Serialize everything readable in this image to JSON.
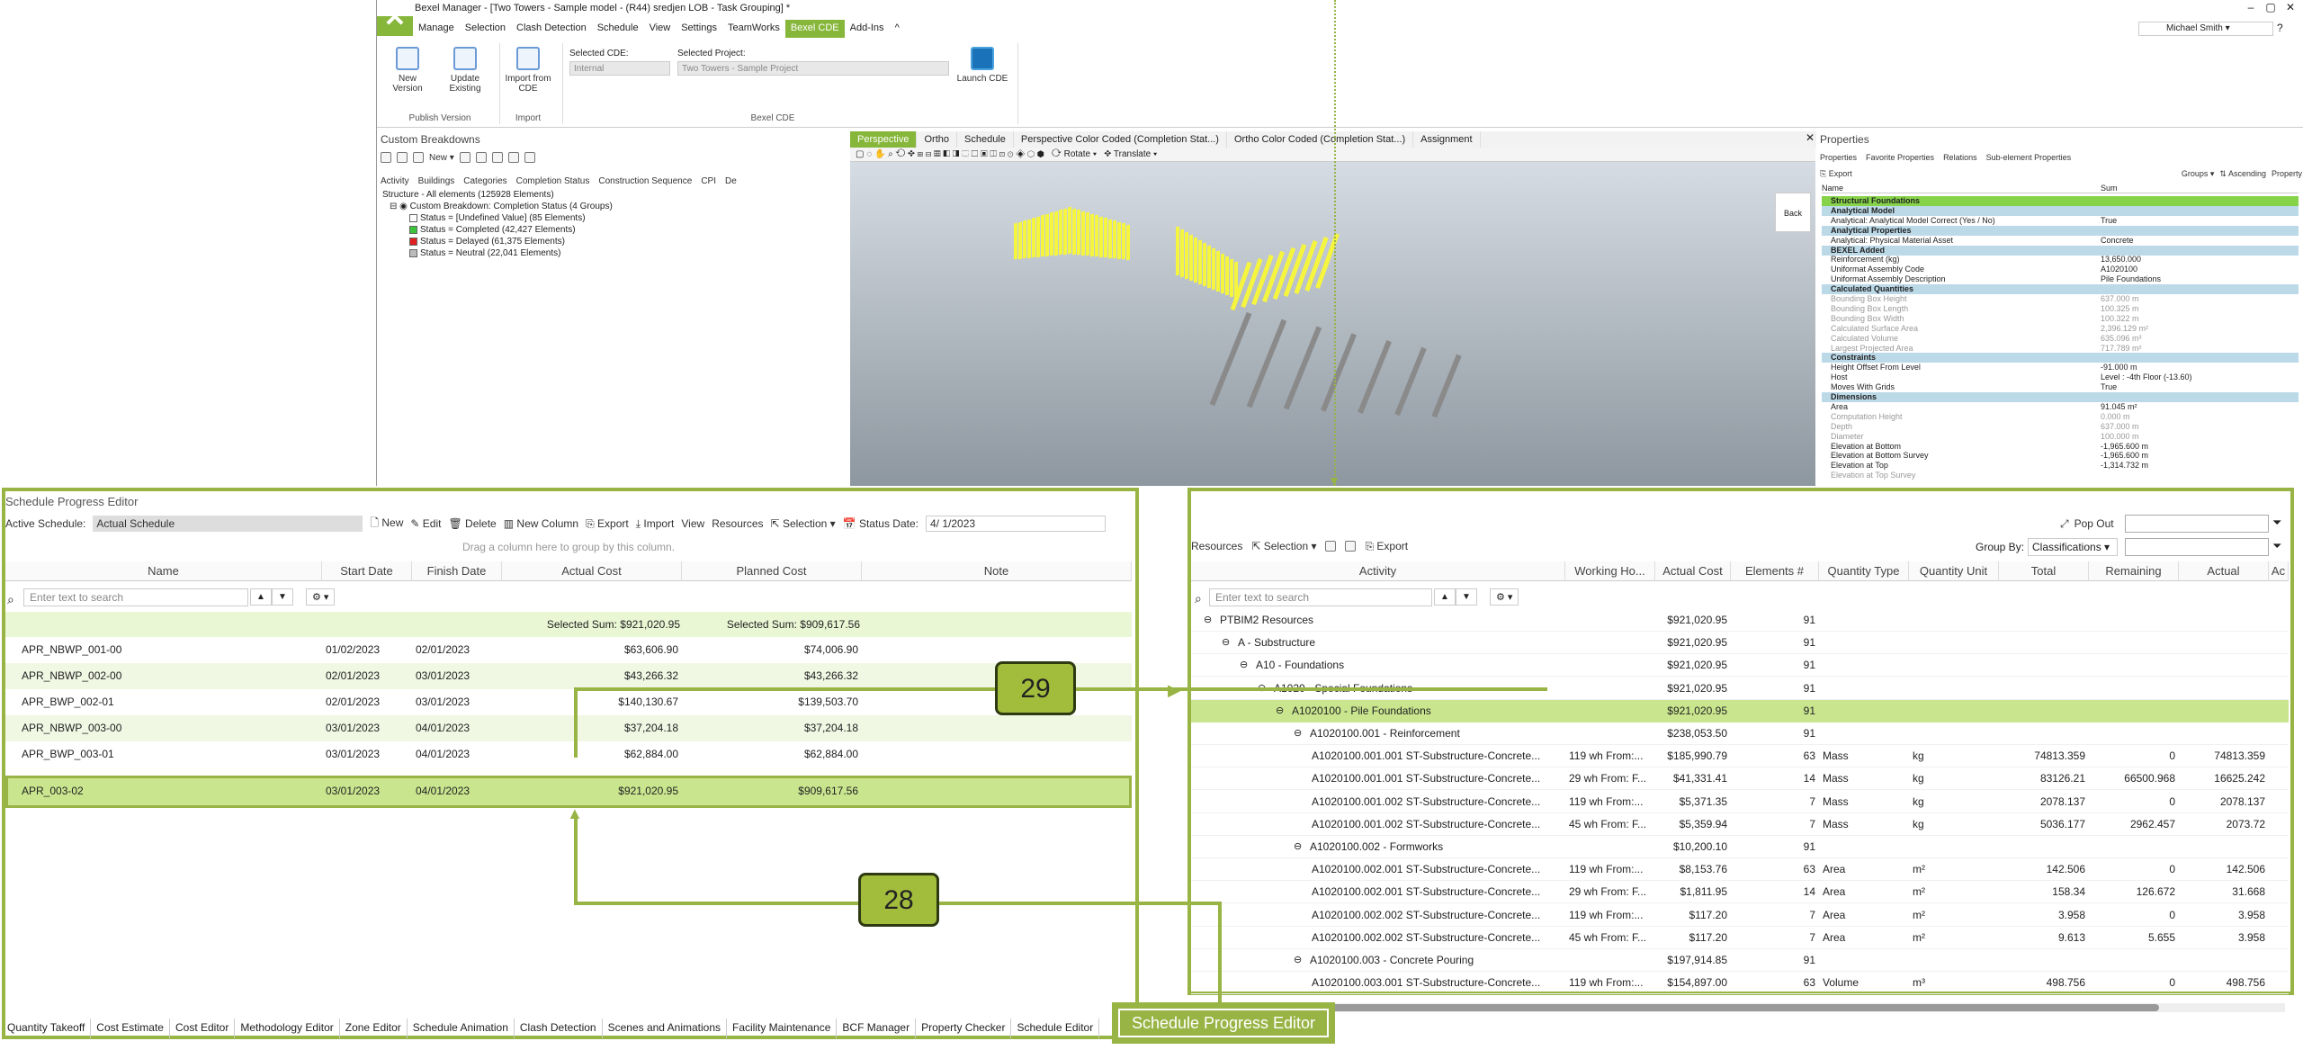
{
  "window": {
    "title": "Bexel Manager - [Two Towers - Sample model - (R44) sredjen LOB - Task Grouping] *",
    "user": "Michael Smith"
  },
  "menu": [
    "Manage",
    "Selection",
    "Clash Detection",
    "Schedule",
    "View",
    "Settings",
    "TeamWorks",
    "Bexel CDE",
    "Add-Ins",
    "^"
  ],
  "ribbon": {
    "new_version": "New Version",
    "update_existing": "Update Existing",
    "import_from_cde": "Import from CDE",
    "launch_cde": "Launch CDE",
    "group_publish": "Publish Version",
    "group_import": "Import",
    "group_bexel": "Bexel CDE",
    "selected_cde_label": "Selected CDE:",
    "selected_cde_value": "Internal",
    "selected_project_label": "Selected Project:",
    "selected_project_value": "Two Towers - Sample Project"
  },
  "custom_breakdowns": {
    "title": "Custom Breakdowns",
    "tabs": [
      "Activity",
      "Buildings",
      "Categories",
      "Completion Status",
      "Construction Sequence",
      "CPI",
      "De"
    ],
    "structure": "Structure - All elements (125928 Elements)",
    "root": "Custom Breakdown: Completion Status (4 Groups)",
    "items": [
      {
        "label": "Status = [Undefined Value] (85 Elements)",
        "color": "#ffffff"
      },
      {
        "label": "Status = Completed (42,427 Elements)",
        "color": "#3bc43b"
      },
      {
        "label": "Status = Delayed (61,375 Elements)",
        "color": "#e02020"
      },
      {
        "label": "Status = Neutral (22,041 Elements)",
        "color": "#bbbbbb"
      }
    ]
  },
  "viewport": {
    "tabs": [
      "Perspective",
      "Ortho",
      "Schedule",
      "Perspective Color Coded (Completion Stat...)",
      "Ortho Color Coded (Completion Stat...)",
      "Assignment"
    ],
    "toolbar_rotate": "Rotate",
    "toolbar_translate": "Translate",
    "cube": "Back"
  },
  "properties": {
    "title": "Properties",
    "tabs": [
      "Properties",
      "Favorite Properties",
      "Relations",
      "Sub-element Properties"
    ],
    "export": "Export",
    "groups": "Groups",
    "ascending": "Ascending",
    "property": "Property",
    "col_name": "Name",
    "col_sum": "Sum",
    "rows": [
      {
        "k": "Structural Foundations",
        "v": "",
        "type": "cat green"
      },
      {
        "k": "Analytical Model",
        "v": "",
        "type": "cat"
      },
      {
        "k": "Analytical: Analytical Model Correct (Yes / No)",
        "v": "True",
        "type": ""
      },
      {
        "k": "Analytical Properties",
        "v": "",
        "type": "cat"
      },
      {
        "k": "Analytical: Physical Material Asset",
        "v": "Concrete",
        "type": ""
      },
      {
        "k": "BEXEL Added",
        "v": "",
        "type": "cat"
      },
      {
        "k": "Reinforcement (kg)",
        "v": "13,650.000",
        "type": ""
      },
      {
        "k": "Uniformat Assembly Code",
        "v": "A1020100",
        "type": ""
      },
      {
        "k": "Uniformat Assembly Description",
        "v": "Pile Foundations",
        "type": ""
      },
      {
        "k": "Calculated Quantities",
        "v": "",
        "type": "cat"
      },
      {
        "k": "Bounding Box Height",
        "v": "637.000 m",
        "type": "gray"
      },
      {
        "k": "Bounding Box Length",
        "v": "100.325 m",
        "type": "gray"
      },
      {
        "k": "Bounding Box Width",
        "v": "100.322 m",
        "type": "gray"
      },
      {
        "k": "Calculated Surface Area",
        "v": "2,396.129 m²",
        "type": "gray"
      },
      {
        "k": "Calculated Volume",
        "v": "635.096 m³",
        "type": "gray"
      },
      {
        "k": "Largest Projected Area",
        "v": "717.789 m²",
        "type": "gray"
      },
      {
        "k": "Constraints",
        "v": "",
        "type": "cat"
      },
      {
        "k": "Height Offset From Level",
        "v": "-91.000 m",
        "type": ""
      },
      {
        "k": "Host",
        "v": "Level : -4th Floor (-13.60)",
        "type": ""
      },
      {
        "k": "Moves With Grids",
        "v": "True",
        "type": ""
      },
      {
        "k": "Dimensions",
        "v": "",
        "type": "cat"
      },
      {
        "k": "Area",
        "v": "91.045 m²",
        "type": ""
      },
      {
        "k": "Computation Height",
        "v": "0.000 m",
        "type": "gray"
      },
      {
        "k": "Depth",
        "v": "637.000 m",
        "type": "gray"
      },
      {
        "k": "Diameter",
        "v": "100.000 m",
        "type": "gray"
      },
      {
        "k": "Elevation at Bottom",
        "v": "-1,965.600 m",
        "type": ""
      },
      {
        "k": "Elevation at Bottom Survey",
        "v": "-1,965.600 m",
        "type": ""
      },
      {
        "k": "Elevation at Top",
        "v": "-1,314.732 m",
        "type": ""
      },
      {
        "k": "Elevation at Top Survey",
        "v": "",
        "type": "gray"
      }
    ]
  },
  "spe": {
    "title": "Schedule Progress Editor",
    "active_schedule_label": "Active Schedule:",
    "active_schedule_value": "Actual Schedule",
    "tb_new": "New",
    "tb_edit": "Edit",
    "tb_delete": "Delete",
    "tb_new_column": "New Column",
    "tb_export": "Export",
    "tb_import": "Import",
    "tb_view": "View",
    "tb_resources": "Resources",
    "tb_selection": "Selection",
    "status_date_label": "Status Date:",
    "status_date_value": "4/ 1/2023",
    "group_hint": "Drag a column here to group by this column.",
    "columns": [
      "Name",
      "Start Date",
      "Finish Date",
      "Actual Cost",
      "Planned Cost",
      "Note"
    ],
    "search_placeholder": "Enter text to search",
    "selected_sum_actual": "Selected Sum: $921,020.95",
    "selected_sum_planned": "Selected Sum: $909,617.56",
    "rows": [
      {
        "name": "APR_NBWP_001-00",
        "start": "01/02/2023",
        "finish": "02/01/2023",
        "actual": "$63,606.90",
        "planned": "$74,006.90"
      },
      {
        "name": "APR_NBWP_002-00",
        "start": "02/01/2023",
        "finish": "03/01/2023",
        "actual": "$43,266.32",
        "planned": "$43,266.32"
      },
      {
        "name": "APR_BWP_002-01",
        "start": "02/01/2023",
        "finish": "03/01/2023",
        "actual": "$140,130.67",
        "planned": "$139,503.70"
      },
      {
        "name": "APR_NBWP_003-00",
        "start": "03/01/2023",
        "finish": "04/01/2023",
        "actual": "$37,204.18",
        "planned": "$37,204.18"
      },
      {
        "name": "APR_BWP_003-01",
        "start": "03/01/2023",
        "finish": "04/01/2023",
        "actual": "$62,884.00",
        "planned": "$62,884.00"
      },
      {
        "name": "APR_003-02",
        "start": "03/01/2023",
        "finish": "04/01/2023",
        "actual": "$921,020.95",
        "planned": "$909,617.56"
      }
    ]
  },
  "resources": {
    "pop_out": "Pop Out",
    "resources_label": "Resources",
    "selection": "Selection",
    "export": "Export",
    "group_by_label": "Group By:",
    "group_by_value": "Classifications",
    "columns": [
      "Activity",
      "Working Ho...",
      "Actual Cost",
      "Elements #",
      "Quantity Type",
      "Quantity Unit",
      "Total",
      "Remaining",
      "Actual",
      "Ac"
    ],
    "search_placeholder": "Enter text to search",
    "rows": [
      {
        "indent": 0,
        "exp": "−",
        "activity": "PTBIM2 Resources",
        "wh": "",
        "cost": "$921,020.95",
        "el": "91",
        "qt": "",
        "qu": "",
        "total": "",
        "rem": "",
        "act": ""
      },
      {
        "indent": 1,
        "exp": "−",
        "activity": "A - Substructure",
        "wh": "",
        "cost": "$921,020.95",
        "el": "91",
        "qt": "",
        "qu": "",
        "total": "",
        "rem": "",
        "act": ""
      },
      {
        "indent": 2,
        "exp": "−",
        "activity": "A10 - Foundations",
        "wh": "",
        "cost": "$921,020.95",
        "el": "91",
        "qt": "",
        "qu": "",
        "total": "",
        "rem": "",
        "act": ""
      },
      {
        "indent": 3,
        "exp": "−",
        "activity": "A1020 - Special Foundations",
        "wh": "",
        "cost": "$921,020.95",
        "el": "91",
        "qt": "",
        "qu": "",
        "total": "",
        "rem": "",
        "act": ""
      },
      {
        "indent": 4,
        "exp": "−",
        "activity": "A1020100 - Pile Foundations",
        "wh": "",
        "cost": "$921,020.95",
        "el": "91",
        "qt": "",
        "qu": "",
        "total": "",
        "rem": "",
        "act": ""
      },
      {
        "indent": 5,
        "exp": "−",
        "activity": "A1020100.001 - Reinforcement",
        "wh": "",
        "cost": "$238,053.50",
        "el": "91",
        "qt": "",
        "qu": "",
        "total": "",
        "rem": "",
        "act": ""
      },
      {
        "indent": 6,
        "exp": "",
        "activity": "A1020100.001.001 ST-Substructure-Concrete...",
        "wh": "119 wh   From:...",
        "cost": "$185,990.79",
        "el": "63",
        "qt": "Mass",
        "qu": "kg",
        "total": "74813.359",
        "rem": "0",
        "act": "74813.359"
      },
      {
        "indent": 6,
        "exp": "",
        "activity": "A1020100.001.001 ST-Substructure-Concrete...",
        "wh": "29 wh   From: F...",
        "cost": "$41,331.41",
        "el": "14",
        "qt": "Mass",
        "qu": "kg",
        "total": "83126.21",
        "rem": "66500.968",
        "act": "16625.242"
      },
      {
        "indent": 6,
        "exp": "",
        "activity": "A1020100.001.002 ST-Substructure-Concrete...",
        "wh": "119 wh   From:...",
        "cost": "$5,371.35",
        "el": "7",
        "qt": "Mass",
        "qu": "kg",
        "total": "2078.137",
        "rem": "0",
        "act": "2078.137"
      },
      {
        "indent": 6,
        "exp": "",
        "activity": "A1020100.001.002 ST-Substructure-Concrete...",
        "wh": "45 wh   From: F...",
        "cost": "$5,359.94",
        "el": "7",
        "qt": "Mass",
        "qu": "kg",
        "total": "5036.177",
        "rem": "2962.457",
        "act": "2073.72"
      },
      {
        "indent": 5,
        "exp": "−",
        "activity": "A1020100.002 - Formworks",
        "wh": "",
        "cost": "$10,200.10",
        "el": "91",
        "qt": "",
        "qu": "",
        "total": "",
        "rem": "",
        "act": ""
      },
      {
        "indent": 6,
        "exp": "",
        "activity": "A1020100.002.001 ST-Substructure-Concrete...",
        "wh": "119 wh   From:...",
        "cost": "$8,153.76",
        "el": "63",
        "qt": "Area",
        "qu": "m²",
        "total": "142.506",
        "rem": "0",
        "act": "142.506"
      },
      {
        "indent": 6,
        "exp": "",
        "activity": "A1020100.002.001 ST-Substructure-Concrete...",
        "wh": "29 wh   From: F...",
        "cost": "$1,811.95",
        "el": "14",
        "qt": "Area",
        "qu": "m²",
        "total": "158.34",
        "rem": "126.672",
        "act": "31.668"
      },
      {
        "indent": 6,
        "exp": "",
        "activity": "A1020100.002.002 ST-Substructure-Concrete...",
        "wh": "119 wh   From:...",
        "cost": "$117.20",
        "el": "7",
        "qt": "Area",
        "qu": "m²",
        "total": "3.958",
        "rem": "0",
        "act": "3.958"
      },
      {
        "indent": 6,
        "exp": "",
        "activity": "A1020100.002.002 ST-Substructure-Concrete...",
        "wh": "45 wh   From: F...",
        "cost": "$117.20",
        "el": "7",
        "qt": "Area",
        "qu": "m²",
        "total": "9.613",
        "rem": "5.655",
        "act": "3.958"
      },
      {
        "indent": 5,
        "exp": "−",
        "activity": "A1020100.003 - Concrete Pouring",
        "wh": "",
        "cost": "$197,914.85",
        "el": "91",
        "qt": "",
        "qu": "",
        "total": "",
        "rem": "",
        "act": ""
      },
      {
        "indent": 6,
        "exp": "",
        "activity": "A1020100.003.001 ST-Substructure-Concrete...",
        "wh": "119 wh   From:...",
        "cost": "$154,897.00",
        "el": "63",
        "qt": "Volume",
        "qu": "m³",
        "total": "498.756",
        "rem": "0",
        "act": "498.756"
      }
    ]
  },
  "bottom_tabs": [
    "Quantity Takeoff",
    "Cost Estimate",
    "Cost Editor",
    "Methodology Editor",
    "Zone Editor",
    "Schedule Animation",
    "Clash Detection",
    "Scenes and Animations",
    "Facility Maintenance",
    "BCF Manager",
    "Property Checker",
    "Schedule Editor"
  ],
  "spe_tab_label": "Schedule Progress Editor",
  "callouts": {
    "a": "29",
    "b": "28"
  },
  "colors": {
    "accent": "#98b444",
    "highlight_row": "#c9e68f",
    "alt_row": "#f0f7e3",
    "sum_row": "#e9f7d4"
  }
}
